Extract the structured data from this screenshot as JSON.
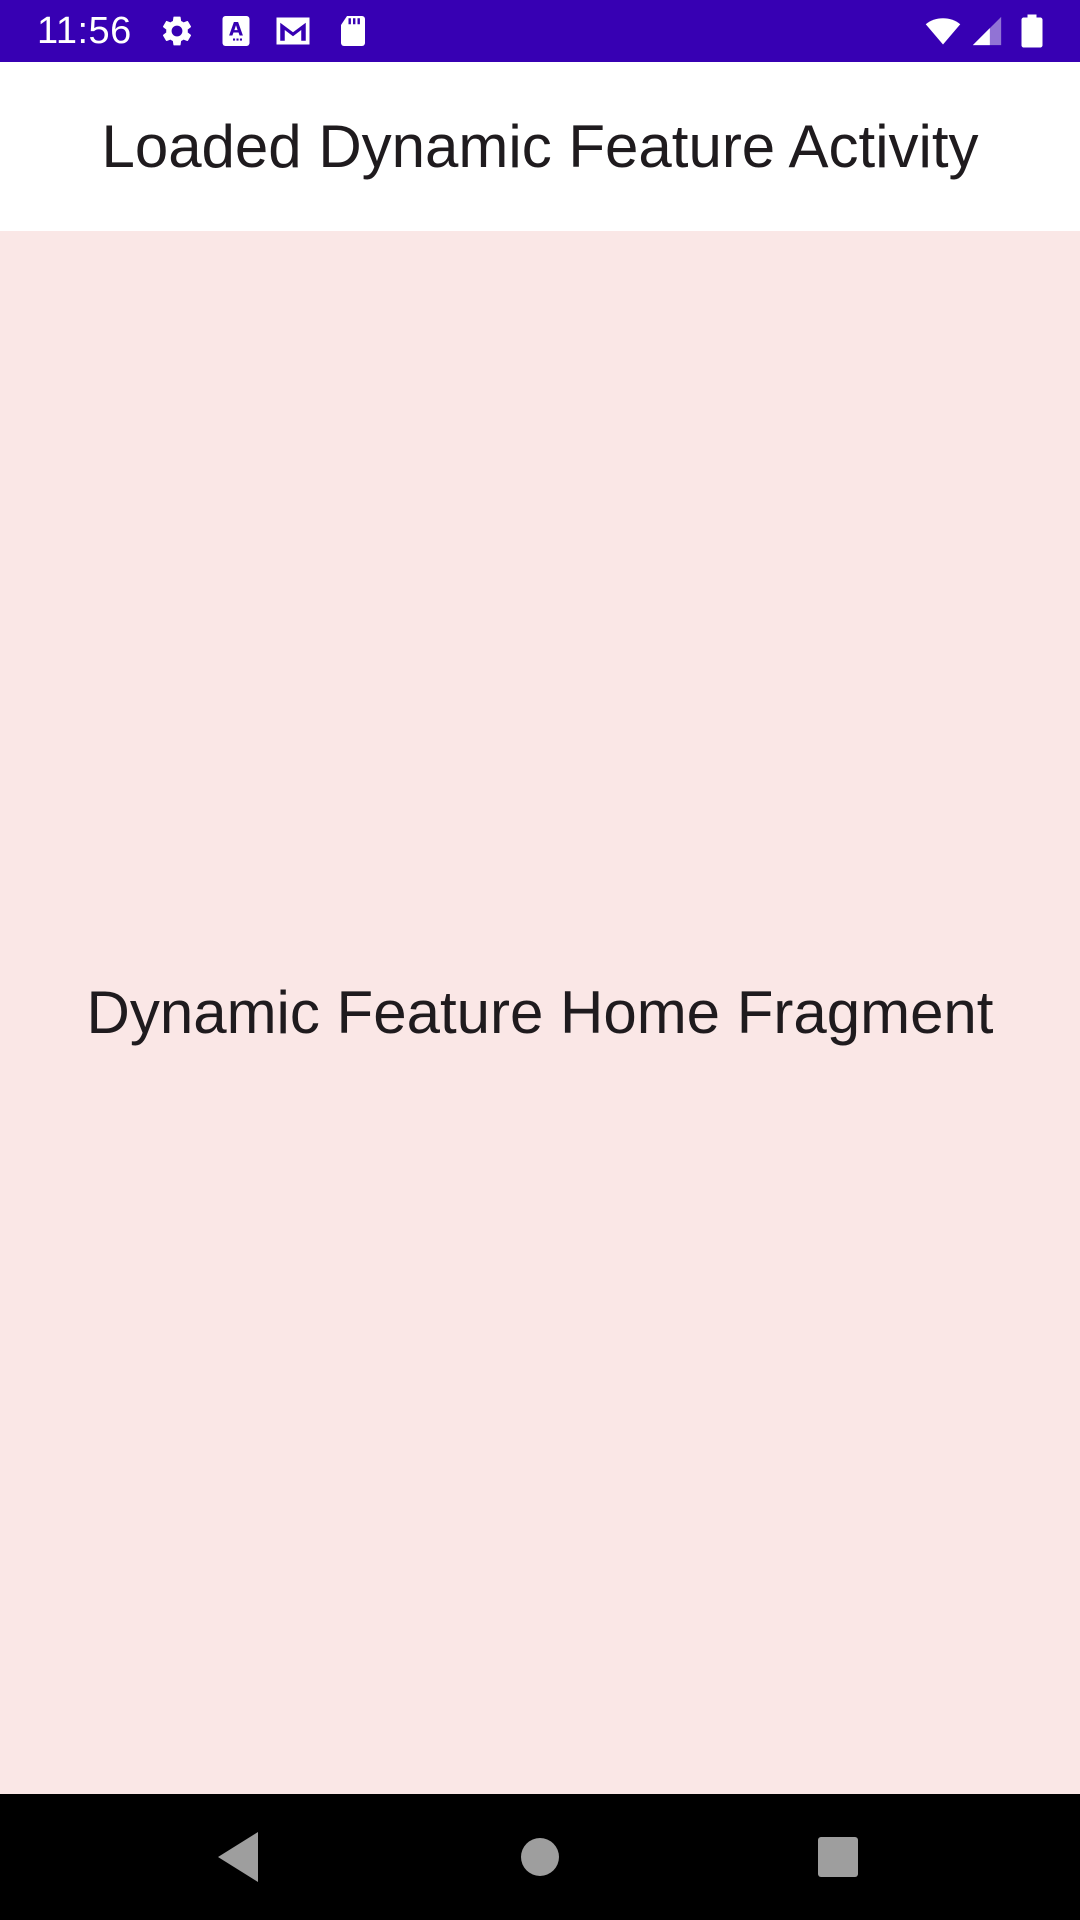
{
  "status_bar": {
    "time": "11:56",
    "color": "#3700b3",
    "left_icons": [
      "settings-icon",
      "text-accessibility-icon",
      "gmail-icon",
      "sd-card-icon"
    ],
    "right_icons": [
      "wifi-icon",
      "cellular-signal-icon",
      "battery-icon"
    ]
  },
  "app_bar": {
    "title": "Loaded Dynamic Feature Activity"
  },
  "content": {
    "background": "#fae7e6",
    "label": "Dynamic Feature Home Fragment"
  },
  "nav_bar": {
    "buttons": [
      "back-icon",
      "home-icon",
      "recents-icon"
    ]
  }
}
